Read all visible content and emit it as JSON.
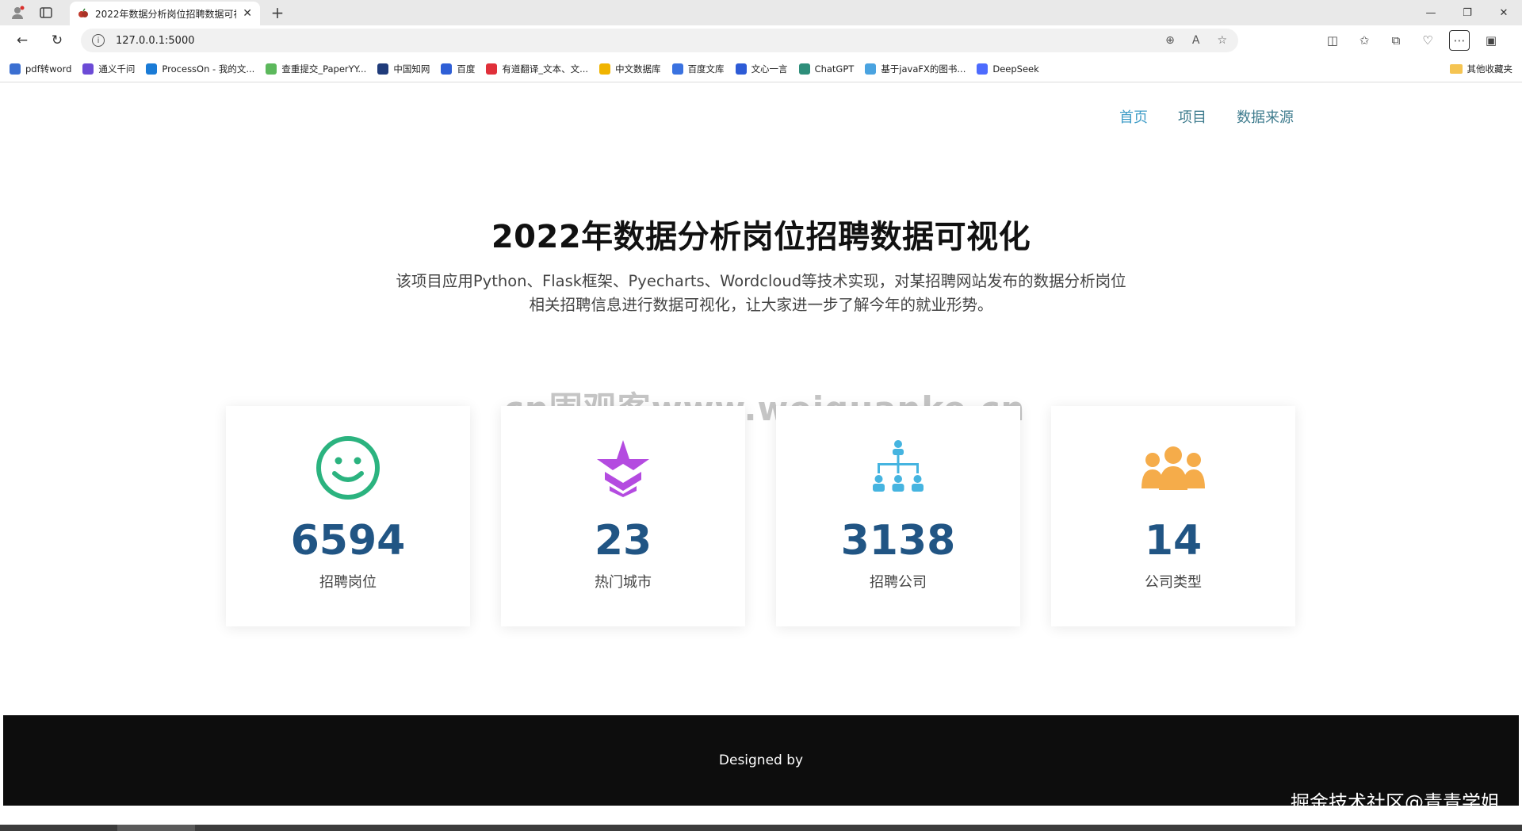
{
  "browser": {
    "tab_title": "2022年数据分析岗位招聘数据可视化",
    "url": "127.0.0.1:5000",
    "bookmarks": [
      {
        "label": "pdf转word",
        "color": "#3b6fd1"
      },
      {
        "label": "通义千问",
        "color": "#6c4bd6"
      },
      {
        "label": "ProcessOn - 我的文...",
        "color": "#1a7bd6"
      },
      {
        "label": "查重提交_PaperYY...",
        "color": "#5cb85c"
      },
      {
        "label": "中国知网",
        "color": "#1f3b7a"
      },
      {
        "label": "百度",
        "color": "#2f5fd6"
      },
      {
        "label": "有道翻译_文本、文...",
        "color": "#e0303a"
      },
      {
        "label": "中文数据库",
        "color": "#f0b400"
      },
      {
        "label": "百度文库",
        "color": "#3a72e0"
      },
      {
        "label": "文心一言",
        "color": "#2d5bd6"
      },
      {
        "label": "ChatGPT",
        "color": "#2e8e7a"
      },
      {
        "label": "基于javaFX的图书...",
        "color": "#4aa3e0"
      },
      {
        "label": "DeepSeek",
        "color": "#4d6bfe"
      }
    ],
    "other_bookmarks": "其他收藏夹"
  },
  "site": {
    "nav": [
      {
        "label": "首页",
        "active": true
      },
      {
        "label": "项目",
        "active": false
      },
      {
        "label": "数据来源",
        "active": false
      }
    ],
    "title": "2022年数据分析岗位招聘数据可视化",
    "desc_line1": "该项目应用Python、Flask框架、Pyecharts、Wordcloud等技术实现，对某招聘网站发布的数据分析岗位",
    "desc_line2": "相关招聘信息进行数据可视化，让大家进一步了解今年的就业形势。",
    "watermark": "cn围观客www.weiguanke.cn",
    "stats": [
      {
        "value": "6594",
        "label": "招聘岗位",
        "icon": "smiley-icon",
        "color": "#2bb37f"
      },
      {
        "value": "23",
        "label": "热门城市",
        "icon": "star-rank-icon",
        "color": "#b44be0"
      },
      {
        "value": "3138",
        "label": "招聘公司",
        "icon": "org-chart-icon",
        "color": "#45b4e0"
      },
      {
        "value": "14",
        "label": "公司类型",
        "icon": "group-icon",
        "color": "#f5ac4a"
      }
    ],
    "footer_text": "Designed by",
    "corner_watermark": "掘金技术社区@青青学姐"
  }
}
